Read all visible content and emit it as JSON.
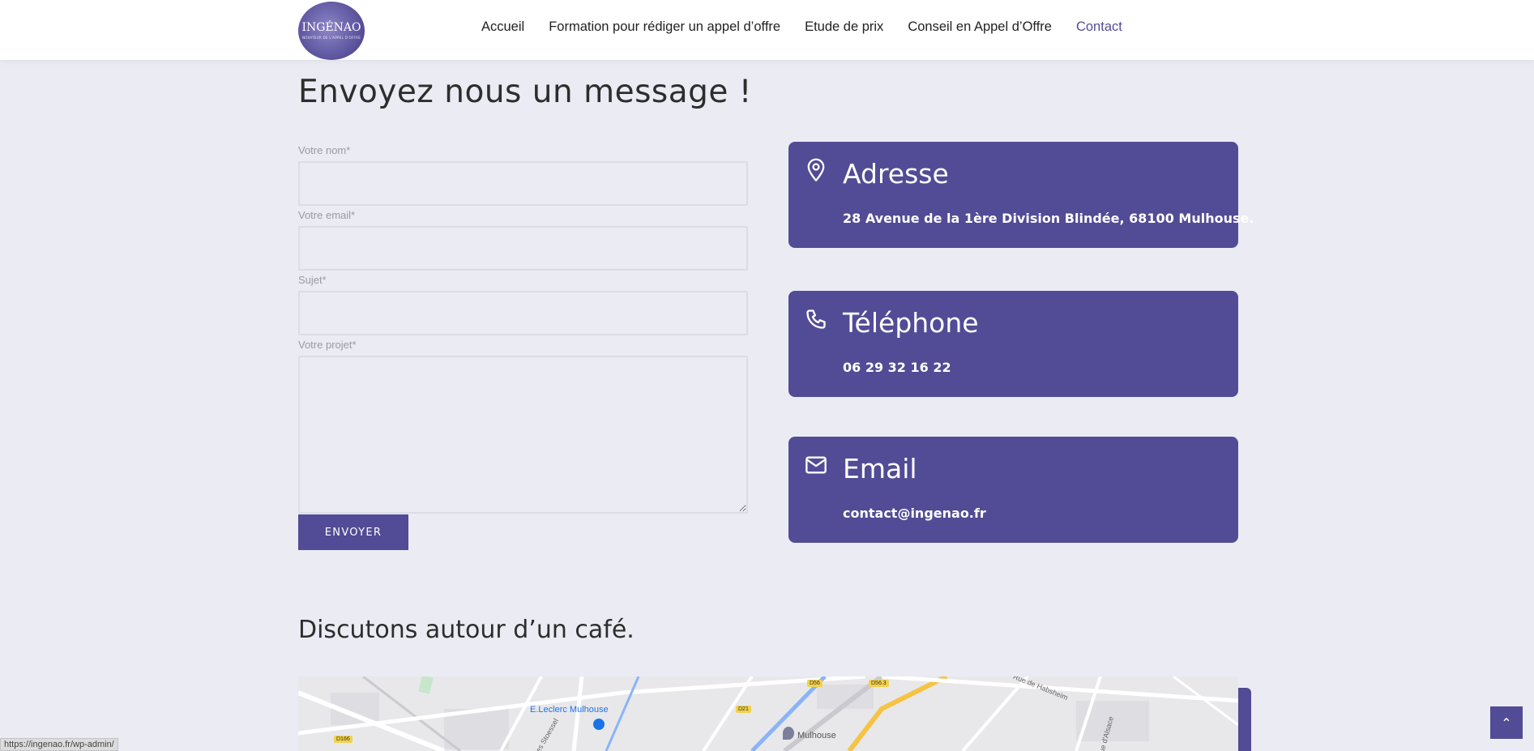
{
  "header": {
    "logo": {
      "text": "INGÉNAO",
      "tagline": "NOVATEUR DE L'APPEL D'OFFRE"
    },
    "nav": [
      {
        "label": "Accueil",
        "active": false
      },
      {
        "label": "Formation pour rédiger un appel d’offre",
        "active": false
      },
      {
        "label": "Etude de prix",
        "active": false
      },
      {
        "label": "Conseil en Appel d’Offre",
        "active": false
      },
      {
        "label": "Contact",
        "active": true
      }
    ]
  },
  "contact_form": {
    "title": "Envoyez nous un message !",
    "fields": [
      {
        "label": "Votre nom*",
        "value": "",
        "type": "input"
      },
      {
        "label": "Votre email*",
        "value": "",
        "type": "input"
      },
      {
        "label": "Sujet*",
        "value": "",
        "type": "input"
      },
      {
        "label": "Votre projet*",
        "value": "",
        "type": "textarea"
      }
    ],
    "submit_label": "ENVOYER"
  },
  "info_cards": [
    {
      "icon": "map-pin-icon",
      "title": "Adresse",
      "text": "28 Avenue de la 1ère Division Blindée, 68100 Mulhouse."
    },
    {
      "icon": "phone-icon",
      "title": "Téléphone",
      "text": "06 29 32 16 22"
    },
    {
      "icon": "mail-icon",
      "title": "Email",
      "text": "contact@ingenao.fr"
    }
  ],
  "map_section": {
    "title": "Discutons autour d’un café.",
    "labels": {
      "leclerc": "E.Leclerc Mulhouse",
      "mulhouse": "Mulhouse",
      "rue_habsheim": "Rue de Habsheim",
      "rue_stoessel": "rles Stoessel",
      "rue_alsace": "Rue d'Alsace"
    },
    "road_tags": [
      "D56",
      "D56.3",
      "D21",
      "D166"
    ]
  },
  "status_bar": {
    "url": "https://ingenao.fr/wp-admin/"
  },
  "back_to_top": {
    "symbol": "⌃"
  },
  "colors": {
    "accent": "#524b95",
    "background": "#ebebf3",
    "nav_active": "#534c96"
  }
}
